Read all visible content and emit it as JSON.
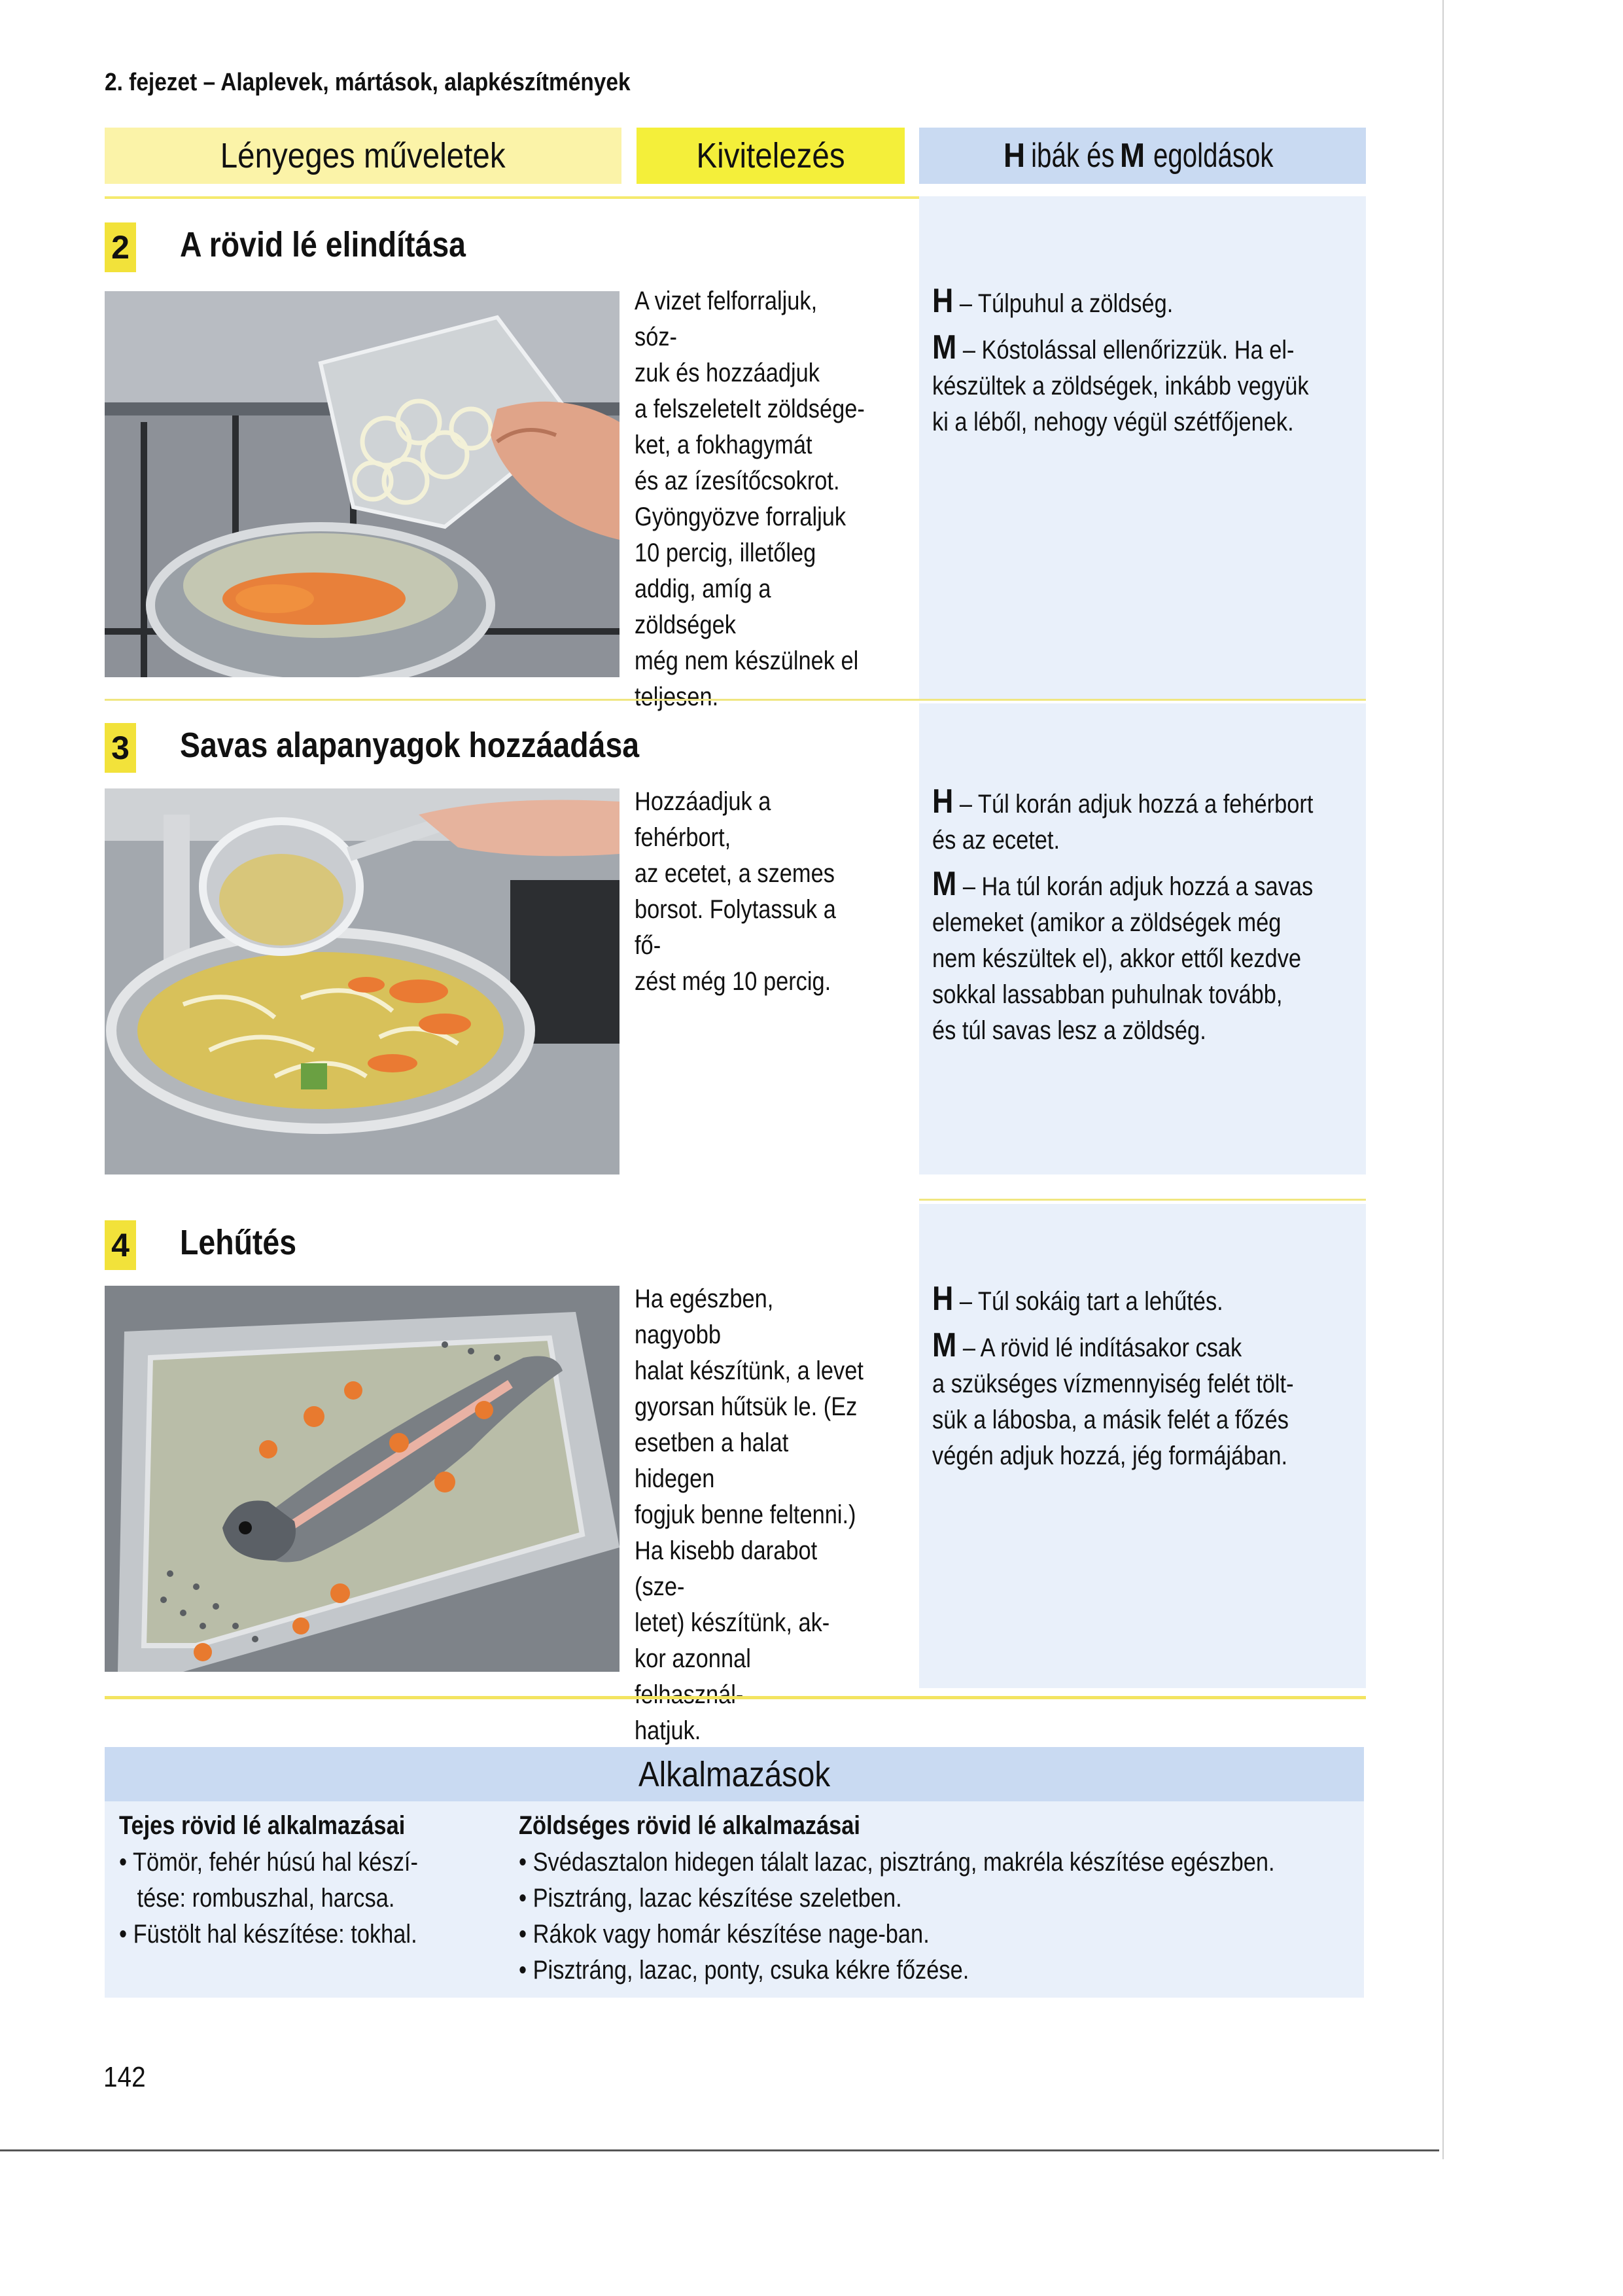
{
  "chapter_title": "2. fejezet – Alaplevek, mártások, alapkészítmények",
  "columns": {
    "left": "Lényeges műveletek",
    "middle": "Kivitelezés",
    "right_prefix": "H",
    "right_mid": "ibák és ",
    "right_prefix2": "M",
    "right_end": "egoldások"
  },
  "sections": [
    {
      "number": "2",
      "title": "A rövid lé elindítása",
      "description_lines": [
        "A vizet felforraljuk, sóz-",
        "zuk és hozzáadjuk",
        "a felszeleteIt zöldsége-",
        "ket, a fokhagymát",
        "és az ízesítőcsokrot.",
        "Gyöngyözve forraljuk",
        "10 percig, illetőleg",
        "addig, amíg a zöldségek",
        "még nem készülnek el",
        "teljesen."
      ],
      "problem_letter": "H",
      "problem_text": " – Túlpuhul a zöldség.",
      "solution_letter": "M",
      "solution_lines": [
        " – Kóstolással ellenőrizzük. Ha el-",
        "készültek a zöldségek, inkább vegyük",
        "ki a léből, nehogy végül szétfőjenek."
      ]
    },
    {
      "number": "3",
      "title": "Savas alapanyagok hozzáadása",
      "description_lines": [
        "Hozzáadjuk a fehérbort,",
        "az ecetet, a szemes",
        "borsot. Folytassuk a fő-",
        "zést még 10 percig."
      ],
      "problem_letter": "H",
      "problem_lines": [
        " – Túl korán adjuk hozzá a fehérbort",
        "és az ecetet."
      ],
      "solution_letter": "M",
      "solution_lines": [
        " – Ha túl korán adjuk hozzá a savas",
        "elemeket (amikor a zöldségek még",
        "nem készültek el), akkor ettől kezdve",
        "sokkal lassabban puhulnak tovább,",
        "és túl savas lesz a zöldség."
      ]
    },
    {
      "number": "4",
      "title": "Lehűtés",
      "description_lines": [
        "Ha egészben, nagyobb",
        "halat készítünk, a levet",
        "gyorsan hűtsük le. (Ez",
        "esetben a halat hidegen",
        "fogjuk benne feltenni.)",
        "Ha kisebb darabot (sze-",
        "letet) készítünk, ak-",
        "kor azonnal felhasznál-",
        "hatjuk."
      ],
      "problem_letter": "H",
      "problem_text": " – Túl sokáig tart a lehűtés.",
      "solution_letter": "M",
      "solution_lines": [
        " – A rövid lé indításakor csak",
        "a szükséges vízmennyiség felét tölt-",
        "sük a lábosba, a másik felét a főzés",
        "végén adjuk hozzá, jég formájában."
      ]
    }
  ],
  "applications": {
    "title": "Alkalmazások",
    "milk": {
      "heading": "Tejes rövid lé alkalmazásai",
      "items": [
        "• Tömör, fehér húsú hal készí-",
        "tése: rombuszhal, harcsa.",
        "• Füstölt hal készítése: tokhal."
      ]
    },
    "veg": {
      "heading": "Zöldséges rövid lé alkalmazásai",
      "items": [
        "• Svédasztalon hidegen tálalt lazac, pisztráng, makréla készítése egészben.",
        "• Pisztráng, lazac készítése szeletben.",
        "• Rákok vagy homár készítése nage-ban.",
        "• Pisztráng, lazac, ponty, csuka kékre főzése."
      ]
    }
  },
  "page_number": "142"
}
